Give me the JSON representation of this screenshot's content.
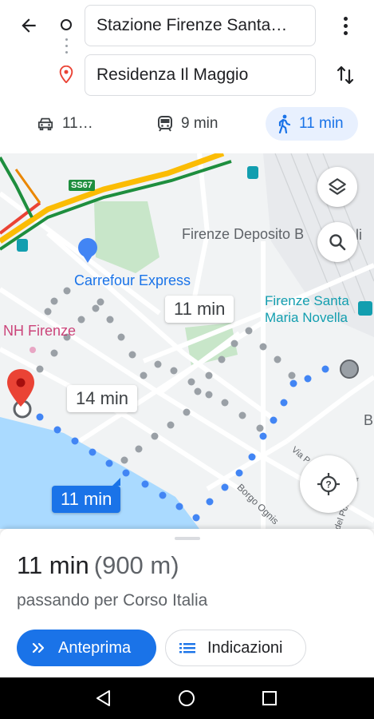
{
  "header": {
    "origin_value": "Stazione Firenze Santa…",
    "destination_value": "Residenza Il Maggio",
    "modes": [
      {
        "name": "car",
        "label": "11…"
      },
      {
        "name": "transit",
        "label": "9 min"
      },
      {
        "name": "walk",
        "label": "11 min",
        "selected": true
      }
    ]
  },
  "map": {
    "labels": {
      "deposito": "Firenze Deposito B",
      "deposito_tail": "li",
      "carrefour": "Carrefour Express",
      "nh": "NH Firenze",
      "smn_line1": "Firenze Santa",
      "smn_line2": "Maria Novella",
      "road_shield": "SS67",
      "street_via": "Via P",
      "street_borgo": "Borgo Ognis",
      "street_porc": "del Porcellana",
      "edge_b": "B"
    },
    "route_times": {
      "alt_1": "11 min",
      "alt_2": "14 min",
      "selected": "11 min"
    },
    "colors": {
      "route_selected": "#4285f4",
      "route_alt": "#9aa0a6",
      "destination_pin": "#ea4335",
      "accent": "#1a73e8"
    }
  },
  "sheet": {
    "duration": "11 min",
    "distance": "(900 m)",
    "via": "passando per Corso Italia",
    "preview_label": "Anteprima",
    "steps_label": "Indicazioni"
  }
}
